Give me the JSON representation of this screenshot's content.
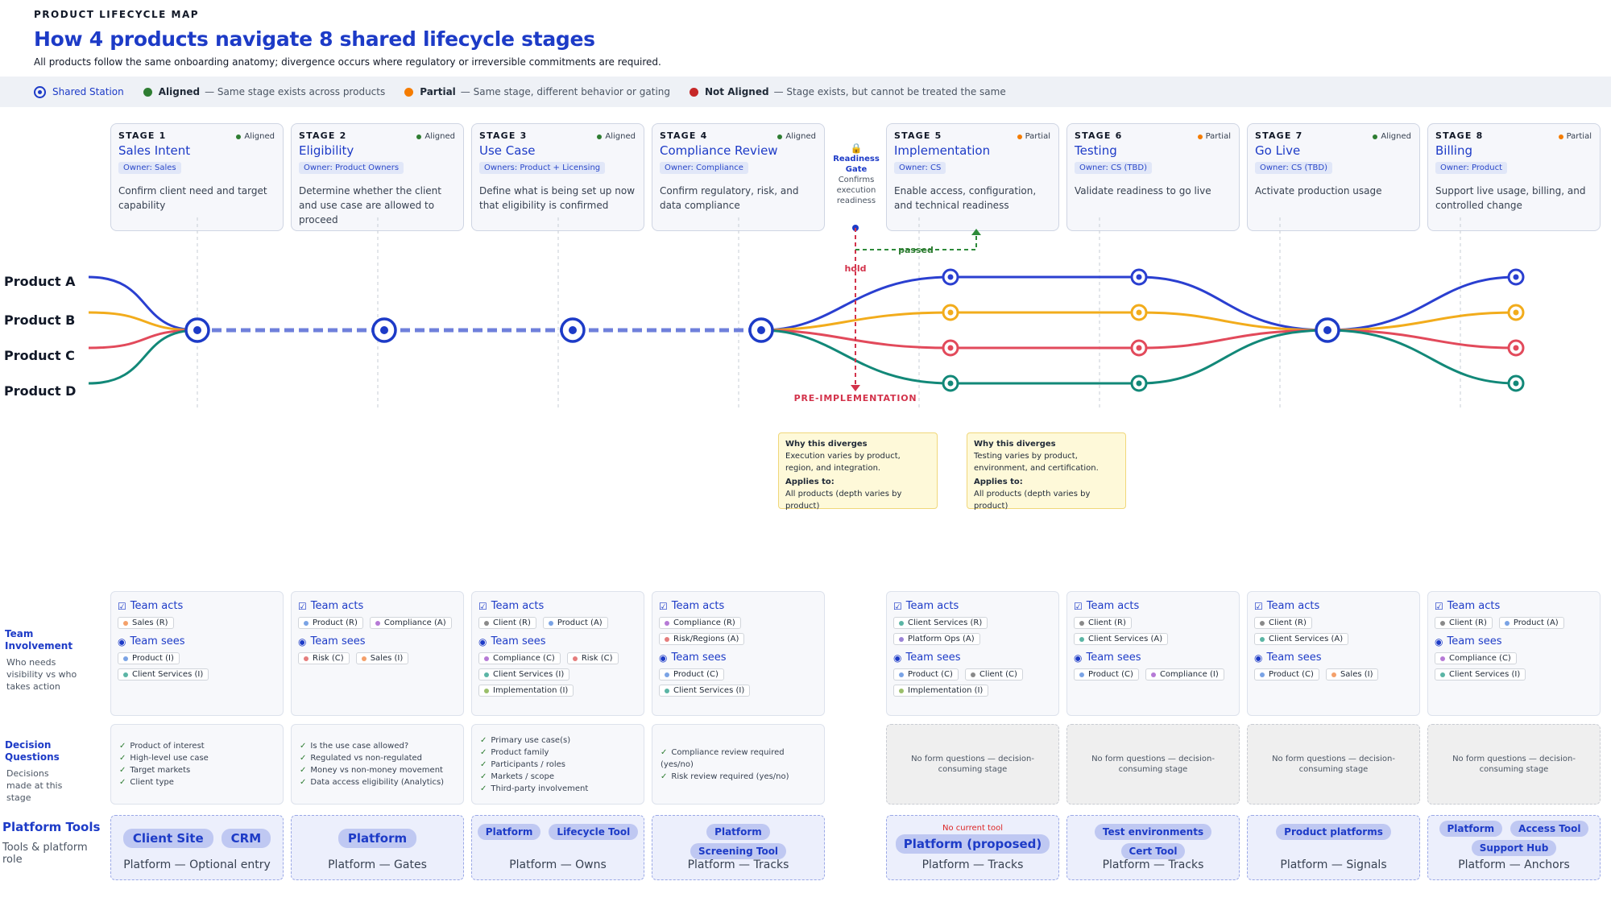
{
  "header": {
    "eyebrow": "PRODUCT LIFECYCLE MAP",
    "title": "How 4 products navigate 8 shared lifecycle stages",
    "subtitle": "All products follow the same onboarding anatomy; divergence occurs where regulatory or irreversible commitments are required."
  },
  "legend": {
    "shared": "Shared Station",
    "aligned": {
      "label": "Aligned",
      "desc": "— Same stage exists across products",
      "color": "#2e7d32"
    },
    "partial": {
      "label": "Partial",
      "desc": "— Same stage, different behavior or gating",
      "color": "#f57c00"
    },
    "not_aligned": {
      "label": "Not Aligned",
      "desc": "— Stage exists, but cannot be treated the same",
      "color": "#c62828"
    }
  },
  "stages": [
    {
      "num": "STAGE 1",
      "status": "Aligned",
      "name": "Sales Intent",
      "owner": "Owner: Sales",
      "desc": "Confirm client need and target capability"
    },
    {
      "num": "STAGE 2",
      "status": "Aligned",
      "name": "Eligibility",
      "owner": "Owner: Product Owners",
      "desc": "Determine whether the client and use case are allowed to proceed"
    },
    {
      "num": "STAGE 3",
      "status": "Aligned",
      "name": "Use Case",
      "owner": "Owners: Product + Licensing",
      "desc": "Define what is being set up now that eligibility is confirmed"
    },
    {
      "num": "STAGE 4",
      "status": "Aligned",
      "name": "Compliance Review",
      "owner": "Owner: Compliance",
      "desc": "Confirm regulatory, risk, and data compliance"
    },
    {
      "num": "STAGE 5",
      "status": "Partial",
      "name": "Implementation",
      "owner": "Owner: CS",
      "desc": "Enable access, configuration, and technical readiness"
    },
    {
      "num": "STAGE 6",
      "status": "Partial",
      "name": "Testing",
      "owner": "Owner: CS (TBD)",
      "desc": "Validate readiness to go live"
    },
    {
      "num": "STAGE 7",
      "status": "Aligned",
      "name": "Go Live",
      "owner": "Owner: CS (TBD)",
      "desc": "Activate production usage"
    },
    {
      "num": "STAGE 8",
      "status": "Partial",
      "name": "Billing",
      "owner": "Owner: Product",
      "desc": "Support live usage, billing, and controlled change"
    }
  ],
  "status_colors": {
    "Aligned": "#2e7d32",
    "Partial": "#f57c00",
    "Not Aligned": "#c62828"
  },
  "gate": {
    "title": "Readiness Gate",
    "desc": "Confirms execution readiness",
    "passed": "passed",
    "hold": "hold",
    "pre": "PRE-IMPLEMENTATION"
  },
  "products": [
    {
      "name": "Product A",
      "color": "#2a3fd0"
    },
    {
      "name": "Product B",
      "color": "#f2ac1c"
    },
    {
      "name": "Product C",
      "color": "#e24a5b"
    },
    {
      "name": "Product D",
      "color": "#128878"
    }
  ],
  "callouts": [
    {
      "h": "Why this diverges",
      "body": "Execution varies by product, region, and integration.",
      "h2": "Applies to:",
      "body2": "All products (depth varies by product)"
    },
    {
      "h": "Why this diverges",
      "body": "Testing varies by product, environment, and certification.",
      "h2": "Applies to:",
      "body2": "All products (depth varies by product)"
    }
  ],
  "sections": {
    "team": {
      "title": "Team Involvement",
      "sub": "Who needs visibility vs who takes action"
    },
    "decision": {
      "title": "Decision Questions",
      "sub": "Decisions made at this stage"
    },
    "platform": {
      "title": "Platform Tools",
      "sub": "Tools & platform role"
    }
  },
  "team_labels": {
    "acts": "Team acts",
    "sees": "Team sees"
  },
  "role_colors": {
    "Sales": "#f4a06a",
    "Product": "#7aa3e5",
    "Client Services": "#5bb5a5",
    "Compliance": "#b67ad6",
    "Risk": "#e57d7d",
    "Client": "#8a8a8a",
    "Risk/Regions": "#e57d7d",
    "Platform Ops": "#9a83d6",
    "Implementation": "#9bbf6b"
  },
  "team": [
    {
      "acts": [
        [
          "Sales",
          "Sales (R)"
        ]
      ],
      "sees": [
        [
          "Product",
          "Product (I)"
        ],
        [
          "Client Services",
          "Client Services (I)"
        ]
      ]
    },
    {
      "acts": [
        [
          "Product",
          "Product (R)"
        ],
        [
          "Compliance",
          "Compliance (A)"
        ]
      ],
      "sees": [
        [
          "Risk",
          "Risk (C)"
        ],
        [
          "Sales",
          "Sales (I)"
        ]
      ]
    },
    {
      "acts": [
        [
          "Client",
          "Client (R)"
        ],
        [
          "Product",
          "Product (A)"
        ]
      ],
      "sees": [
        [
          "Compliance",
          "Compliance (C)"
        ],
        [
          "Risk",
          "Risk (C)"
        ],
        [
          "Client Services",
          "Client Services (I)"
        ],
        [
          "Implementation",
          "Implementation (I)"
        ]
      ]
    },
    {
      "acts": [
        [
          "Compliance",
          "Compliance (R)"
        ],
        [
          "Risk/Regions",
          "Risk/Regions (A)"
        ]
      ],
      "sees": [
        [
          "Product",
          "Product (C)"
        ],
        [
          "Client Services",
          "Client Services (I)"
        ]
      ]
    },
    {
      "acts": [
        [
          "Client Services",
          "Client Services (R)"
        ],
        [
          "Platform Ops",
          "Platform Ops (A)"
        ]
      ],
      "sees": [
        [
          "Product",
          "Product (C)"
        ],
        [
          "Client",
          "Client (C)"
        ],
        [
          "Implementation",
          "Implementation (I)"
        ]
      ]
    },
    {
      "acts": [
        [
          "Client",
          "Client (R)"
        ],
        [
          "Client Services",
          "Client Services (A)"
        ]
      ],
      "sees": [
        [
          "Product",
          "Product (C)"
        ],
        [
          "Compliance",
          "Compliance (I)"
        ]
      ]
    },
    {
      "acts": [
        [
          "Client",
          "Client (R)"
        ],
        [
          "Client Services",
          "Client Services (A)"
        ]
      ],
      "sees": [
        [
          "Product",
          "Product (C)"
        ],
        [
          "Sales",
          "Sales (I)"
        ]
      ]
    },
    {
      "acts": [
        [
          "Client",
          "Client (R)"
        ],
        [
          "Product",
          "Product (A)"
        ]
      ],
      "sees": [
        [
          "Compliance",
          "Compliance (C)"
        ],
        [
          "Client Services",
          "Client Services (I)"
        ]
      ]
    }
  ],
  "decisions": [
    {
      "items": [
        "Product of interest",
        "High-level use case",
        "Target markets",
        "Client type"
      ]
    },
    {
      "items": [
        "Is the use case allowed?",
        "Regulated vs non-regulated",
        "Money vs non-money movement",
        "Data access eligibility (Analytics)"
      ]
    },
    {
      "items": [
        "Primary use case(s)",
        "Product family",
        "Participants / roles",
        "Markets / scope",
        "Third-party involvement"
      ]
    },
    {
      "items": [
        "Compliance review required (yes/no)",
        "Risk review required (yes/no)"
      ]
    },
    {
      "note": "No form questions — decision-consuming stage"
    },
    {
      "note": "No form questions — decision-consuming stage"
    },
    {
      "note": "No form questions — decision-consuming stage"
    },
    {
      "note": "No form questions — decision-consuming stage"
    }
  ],
  "platform": [
    {
      "tools": [
        "Client Site",
        "CRM"
      ],
      "role": "Platform — Optional entry"
    },
    {
      "tools": [
        "Platform"
      ],
      "role": "Platform — Gates"
    },
    {
      "tools": [
        "Platform",
        "Lifecycle Tool"
      ],
      "role": "Platform — Owns"
    },
    {
      "tools": [
        "Platform",
        "Screening Tool"
      ],
      "role": "Platform — Tracks"
    },
    {
      "note": "No current tool",
      "tools": [
        "Platform (proposed)"
      ],
      "role": "Platform — Tracks"
    },
    {
      "tools": [
        "Test environments",
        "Cert Tool"
      ],
      "role": "Platform — Tracks"
    },
    {
      "tools": [
        "Product platforms"
      ],
      "role": "Platform — Signals"
    },
    {
      "tools": [
        "Platform",
        "Access Tool",
        "Support Hub"
      ],
      "role": "Platform — Anchors"
    }
  ]
}
